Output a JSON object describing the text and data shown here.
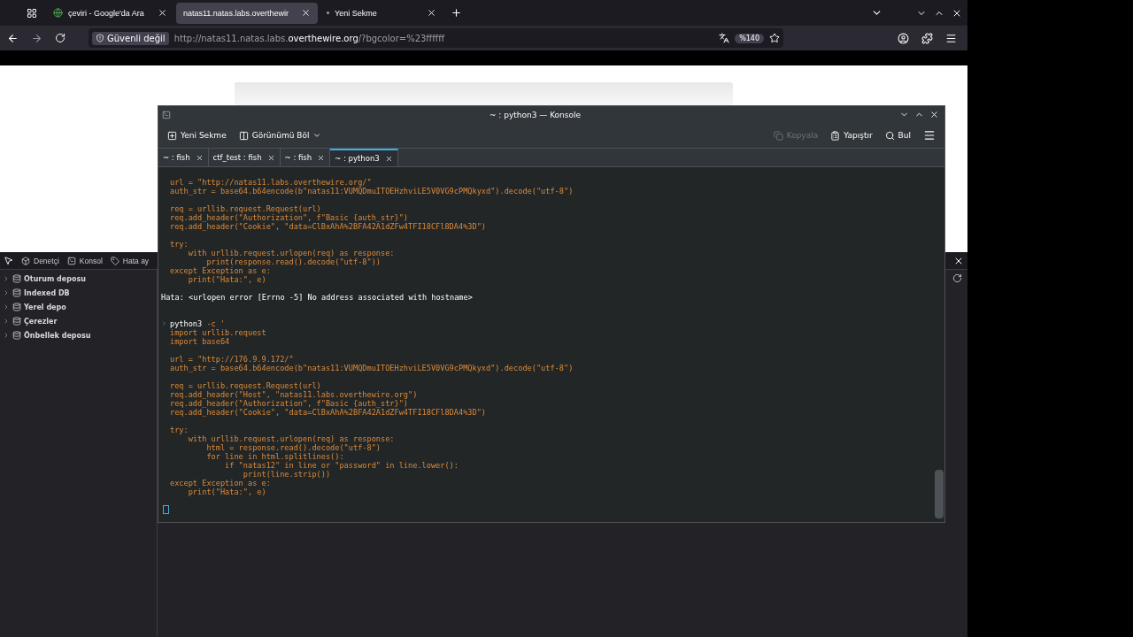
{
  "browser": {
    "tabs": [
      {
        "label": "çeviri - Google'da Ara",
        "selected": false,
        "kind": "site"
      },
      {
        "label": "natas11.natas.labs.overthewir",
        "selected": true,
        "kind": "plain"
      },
      {
        "label": "Yeni Sekme",
        "selected": false,
        "kind": "new"
      }
    ],
    "security_badge": "Güvenli değil",
    "url_prefix": "http://natas11.natas.labs.",
    "url_domain": "overthewire.org",
    "url_suffix": "/?bgcolor=%23ffffff",
    "zoom": "%140"
  },
  "devtools": {
    "tabs": [
      {
        "label": "Denetçi",
        "selected": false
      },
      {
        "label": "Konsol",
        "selected": false
      },
      {
        "label": "Hata ay",
        "selected": false
      }
    ],
    "storage": [
      {
        "label": "Oturum deposu",
        "expanded": false
      },
      {
        "label": "Indexed DB",
        "expanded": false
      },
      {
        "label": "Yerel depo",
        "expanded": false
      },
      {
        "label": "Çerezler",
        "expanded": false
      },
      {
        "label": "Önbellek deposu",
        "expanded": false
      }
    ]
  },
  "konsole": {
    "title": "~ : python3 — Konsole",
    "toolbar": [
      {
        "label": "Yeni Sekme",
        "disabled": false,
        "kind": "newtab"
      },
      {
        "label": "Görünümü Böl",
        "disabled": false,
        "kind": "split"
      },
      {
        "label": "Kopyala",
        "disabled": true,
        "kind": "copy"
      },
      {
        "label": "Yapıştır",
        "disabled": false,
        "kind": "paste"
      },
      {
        "label": "Bul",
        "disabled": false,
        "kind": "find"
      }
    ],
    "tabs": [
      {
        "label": "~ : fish",
        "selected": false
      },
      {
        "label": "ctf_test : fish",
        "selected": false
      },
      {
        "label": "~ : fish",
        "selected": false
      },
      {
        "label": "~ : python3",
        "selected": true
      }
    ],
    "lines": [
      {
        "kind": "code",
        "text": "url = \"http://natas11.labs.overthewire.org/\""
      },
      {
        "kind": "code",
        "text": "auth_str = base64.b64encode(b\"natas11:VUMQDmuITOEHzhviLE5V0VG9cPMQkyxd\").decode(\"utf-8\")"
      },
      {
        "kind": "blank"
      },
      {
        "kind": "code",
        "text": "req = urllib.request.Request(url)"
      },
      {
        "kind": "code",
        "text": "req.add_header(\"Authorization\", f\"Basic {auth_str}\")"
      },
      {
        "kind": "code",
        "text": "req.add_header(\"Cookie\", \"data=ClBxAhA%2BFA42A1dZFw4TFI18CFl8DA4%3D\")"
      },
      {
        "kind": "blank"
      },
      {
        "kind": "code",
        "text": "try:"
      },
      {
        "kind": "code",
        "text": "    with urllib.request.urlopen(req) as response:"
      },
      {
        "kind": "code",
        "text": "        print(response.read().decode(\"utf-8\"))"
      },
      {
        "kind": "code",
        "text": "except Exception as e:"
      },
      {
        "kind": "code",
        "text": "    print(\"Hata:\", e)"
      },
      {
        "kind": "blank"
      },
      {
        "kind": "output",
        "text": "Hata: <urlopen error [Errno -5] No address associated with hostname>"
      },
      {
        "kind": "blank"
      },
      {
        "kind": "blank"
      },
      {
        "kind": "prompt",
        "command": "python3",
        "args": "-c '"
      },
      {
        "kind": "code",
        "text": "import urllib.request"
      },
      {
        "kind": "code",
        "text": "import base64"
      },
      {
        "kind": "blank"
      },
      {
        "kind": "code",
        "text": "url = \"http://176.9.9.172/\""
      },
      {
        "kind": "code",
        "text": "auth_str = base64.b64encode(b\"natas11:VUMQDmuITOEHzhviLE5V0VG9cPMQkyxd\").decode(\"utf-8\")"
      },
      {
        "kind": "blank"
      },
      {
        "kind": "code",
        "text": "req = urllib.request.Request(url)"
      },
      {
        "kind": "code",
        "text": "req.add_header(\"Host\", \"natas11.labs.overthewire.org\")"
      },
      {
        "kind": "code",
        "text": "req.add_header(\"Authorization\", f\"Basic {auth_str}\")"
      },
      {
        "kind": "code",
        "text": "req.add_header(\"Cookie\", \"data=ClBxAhA%2BFA42A1dZFw4TFI18CFl8DA4%3D\")"
      },
      {
        "kind": "blank"
      },
      {
        "kind": "code",
        "text": "try:"
      },
      {
        "kind": "code",
        "text": "    with urllib.request.urlopen(req) as response:"
      },
      {
        "kind": "code",
        "text": "        html = response.read().decode(\"utf-8\")"
      },
      {
        "kind": "code",
        "text": "        for line in html.splitlines():"
      },
      {
        "kind": "code",
        "text": "            if \"natas12\" in line or \"password\" in line.lower():"
      },
      {
        "kind": "code",
        "text": "                print(line.strip())"
      },
      {
        "kind": "code",
        "text": "except Exception as e:"
      },
      {
        "kind": "code",
        "text": "    print(\"Hata:\", e)"
      },
      {
        "kind": "blank"
      },
      {
        "kind": "cursor"
      }
    ]
  }
}
